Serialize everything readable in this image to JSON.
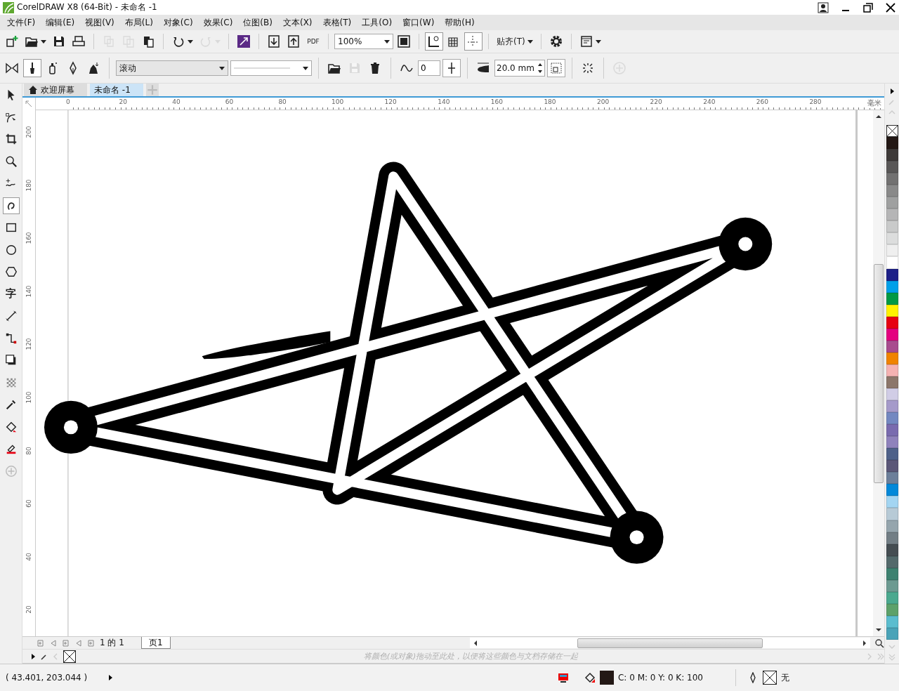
{
  "window": {
    "title": "CorelDRAW X8 (64-Bit) - 未命名 -1"
  },
  "menu": [
    "文件(F)",
    "编辑(E)",
    "视图(V)",
    "布局(L)",
    "对象(C)",
    "效果(C)",
    "位图(B)",
    "文本(X)",
    "表格(T)",
    "工具(O)",
    "窗口(W)",
    "帮助(H)"
  ],
  "toolbar": {
    "groups": [
      [
        {
          "kind": "new",
          "disabled": false
        },
        {
          "kind": "open",
          "disabled": false,
          "menu": true
        },
        {
          "kind": "save",
          "disabled": false
        },
        {
          "kind": "print",
          "disabled": false
        }
      ],
      [
        {
          "kind": "cut",
          "disabled": true
        },
        {
          "kind": "copy",
          "disabled": true
        },
        {
          "kind": "paste",
          "disabled": false
        }
      ],
      [
        {
          "kind": "undo",
          "disabled": false,
          "menu": true
        },
        {
          "kind": "redo",
          "disabled": true,
          "menu": true
        }
      ],
      [
        {
          "kind": "launch",
          "disabled": false
        }
      ],
      [
        {
          "kind": "import",
          "disabled": false
        },
        {
          "kind": "export",
          "disabled": false
        },
        {
          "kind": "pdf",
          "label": "PDF",
          "disabled": false
        }
      ],
      [
        {
          "kind": "zoom",
          "value": "100%"
        },
        {
          "kind": "fullscreen",
          "disabled": false
        }
      ],
      [
        {
          "kind": "rulers",
          "on": true
        },
        {
          "kind": "grid",
          "on": false
        },
        {
          "kind": "guidelines",
          "on": true
        }
      ],
      [
        {
          "kind": "snap",
          "label": "贴齐(T)",
          "menu": true
        }
      ],
      [
        {
          "kind": "options",
          "disabled": false
        }
      ],
      [
        {
          "kind": "window",
          "disabled": false,
          "menu": true
        }
      ]
    ]
  },
  "property_bar": {
    "groups": [
      [
        {
          "kind": "mirror"
        },
        {
          "kind": "preset",
          "selected": true
        },
        {
          "kind": "sprayer",
          "selected": false
        },
        {
          "kind": "calligraphy",
          "selected": false
        },
        {
          "kind": "pressure",
          "selected": false
        }
      ],
      [
        {
          "kind": "dropdown",
          "value": "滚动"
        },
        {
          "kind": "stroke"
        }
      ],
      [
        {
          "kind": "open",
          "disabled": false
        },
        {
          "kind": "save",
          "disabled": true
        },
        {
          "kind": "delete",
          "disabled": false
        }
      ],
      [
        {
          "kind": "smoothing"
        },
        {
          "kind": "field",
          "value": "0"
        },
        {
          "kind": "slider"
        }
      ],
      [
        {
          "kind": "width"
        },
        {
          "kind": "spin",
          "value": "20.0 mm"
        },
        {
          "kind": "bounding"
        }
      ],
      [
        {
          "kind": "scatter"
        }
      ],
      [
        {
          "kind": "add",
          "disabled": true
        }
      ]
    ]
  },
  "toolbox": [
    {
      "kind": "pick",
      "selected": false
    },
    {
      "kind": "shape",
      "selected": false
    },
    {
      "kind": "crop",
      "selected": false
    },
    {
      "kind": "zoom",
      "selected": false
    },
    {
      "kind": "freehand",
      "selected": false
    },
    {
      "kind": "artistic",
      "selected": true
    },
    {
      "kind": "rectangle",
      "selected": false
    },
    {
      "kind": "ellipse",
      "selected": false
    },
    {
      "kind": "polygon",
      "selected": false
    },
    {
      "kind": "text",
      "label": "字",
      "selected": false
    },
    {
      "kind": "dimension",
      "selected": false
    },
    {
      "kind": "connector",
      "selected": false
    },
    {
      "kind": "shadow",
      "selected": false
    },
    {
      "kind": "transparency",
      "selected": false
    },
    {
      "kind": "eyedropper",
      "selected": false
    },
    {
      "kind": "fill",
      "selected": false
    },
    {
      "kind": "interactive",
      "selected": false
    },
    {
      "kind": "add",
      "selected": false
    }
  ],
  "document_tabs": [
    {
      "label": "欢迎屏幕",
      "selected": false
    },
    {
      "label": "未命名 -1",
      "selected": true
    }
  ],
  "rulers": {
    "unit": "毫米",
    "horizontal": [
      "0",
      "20",
      "40",
      "60",
      "80",
      "100",
      "120",
      "140",
      "160",
      "180",
      "200",
      "220",
      "240",
      "260",
      "280"
    ],
    "vertical": [
      "200",
      "180",
      "160",
      "140",
      "120",
      "100",
      "80",
      "60",
      "40",
      "20"
    ]
  },
  "page_navigator": {
    "count": "1 的 1",
    "pages": [
      {
        "label": "页1",
        "selected": true
      }
    ]
  },
  "color_docker": {
    "hint": "将颜色(或对象)拖动至此处，以便将这些颜色与文档存储在一起"
  },
  "palette": [
    {
      "color": "#231815"
    },
    {
      "color": "#3e3a39"
    },
    {
      "color": "#595757"
    },
    {
      "color": "#727171"
    },
    {
      "color": "#898989"
    },
    {
      "color": "#9fa0a0"
    },
    {
      "color": "#b5b5b6"
    },
    {
      "color": "#c9caca"
    },
    {
      "color": "#dcdddd"
    },
    {
      "color": "#efefef"
    },
    {
      "color": "#ffffff"
    },
    {
      "color": "#1d2088"
    },
    {
      "color": "#00a0e9"
    },
    {
      "color": "#009944"
    },
    {
      "color": "#fff100"
    },
    {
      "color": "#e60012"
    },
    {
      "color": "#e4007f"
    },
    {
      "color": "#a84b8e"
    },
    {
      "color": "#f08300"
    },
    {
      "color": "#f5b2b2"
    },
    {
      "color": "#8c766a"
    },
    {
      "color": "#d1cde6"
    },
    {
      "color": "#a59aca"
    },
    {
      "color": "#7388c1"
    },
    {
      "color": "#796baf"
    },
    {
      "color": "#8f82bc"
    },
    {
      "color": "#4e6189"
    },
    {
      "color": "#5b5778"
    },
    {
      "color": "#6c7f9a"
    },
    {
      "color": "#0288d9"
    },
    {
      "color": "#a3d5f2"
    },
    {
      "color": "#b7cad6"
    },
    {
      "color": "#95a5ad"
    },
    {
      "color": "#727e85"
    },
    {
      "color": "#454d52"
    },
    {
      "color": "#53696b"
    },
    {
      "color": "#3d8170"
    },
    {
      "color": "#6c9a91"
    },
    {
      "color": "#4ba98f"
    },
    {
      "color": "#5da16a"
    },
    {
      "color": "#5bbdcf"
    },
    {
      "color": "#4aa3b8"
    }
  ],
  "status_bar": {
    "coordinates": "( 43.401, 203.044 )",
    "fill": "C: 0 M: 0 Y: 0 K: 100",
    "outline": "无"
  }
}
